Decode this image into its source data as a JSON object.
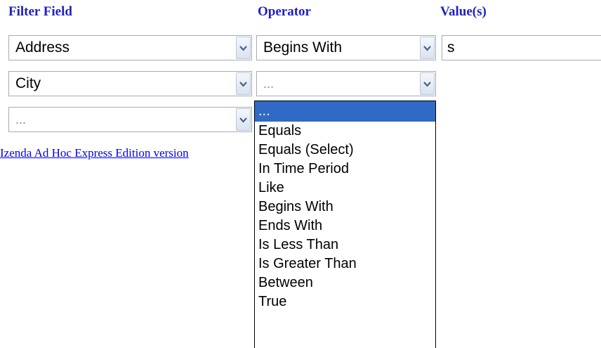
{
  "headers": {
    "filter_field": "Filter Field",
    "operator": "Operator",
    "values": "Value(s)"
  },
  "rows": [
    {
      "field": "Address",
      "operator": "Begins With",
      "value": "s"
    },
    {
      "field": "City",
      "operator": "..."
    },
    {
      "field": "..."
    }
  ],
  "footer_link": "Izenda Ad Hoc Express Edition version",
  "operator_options": [
    "...",
    "Equals",
    "Equals (Select)",
    "In Time Period",
    "Like",
    "Begins With",
    "Ends With",
    "Is Less Than",
    "Is Greater Than",
    "Between",
    "True"
  ],
  "selected_option_index": 0,
  "icons": {
    "dropdown_arrow": "chevron-down-icon"
  },
  "colors": {
    "header_text": "#1f1fc4",
    "link": "#0000ee",
    "selection": "#3169c6",
    "field_border": "#a5acb5"
  }
}
